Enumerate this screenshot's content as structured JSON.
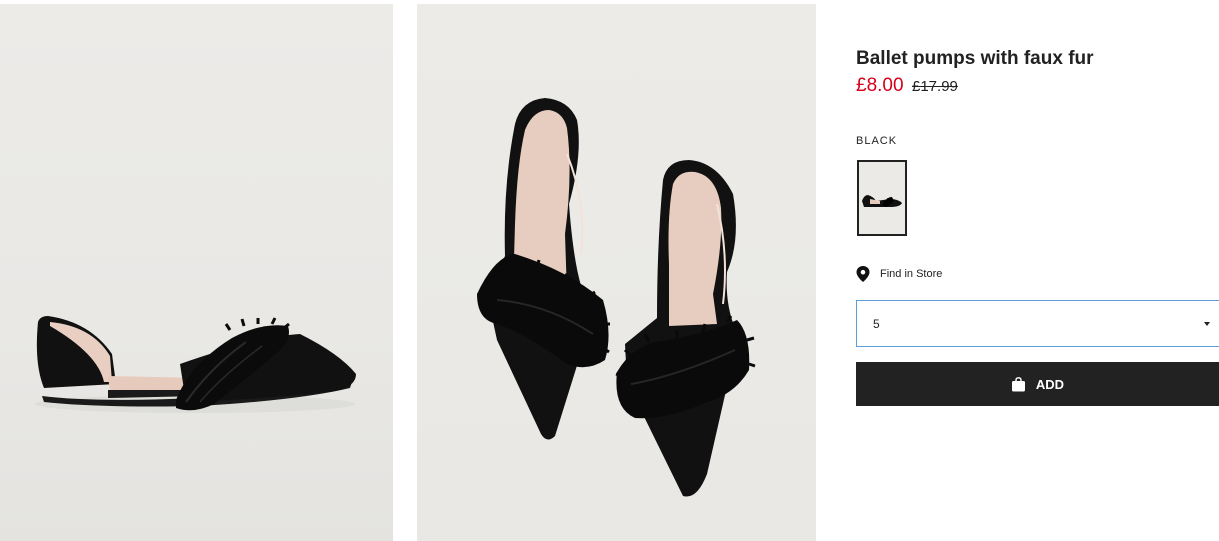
{
  "product": {
    "title": "Ballet pumps with faux fur",
    "price_sale": "£8.00",
    "price_original": "£17.99"
  },
  "color": {
    "label": "BLACK"
  },
  "store": {
    "link_label": "Find in Store",
    "icon": "map-pin-icon"
  },
  "size_select": {
    "value": "5"
  },
  "add_button": {
    "label": "ADD",
    "icon": "shopping-bag-icon"
  },
  "colors": {
    "sale_price": "#d6001c",
    "button_bg": "#222222",
    "select_border": "#5e9ed6",
    "image_bg": "#ebeae7"
  }
}
